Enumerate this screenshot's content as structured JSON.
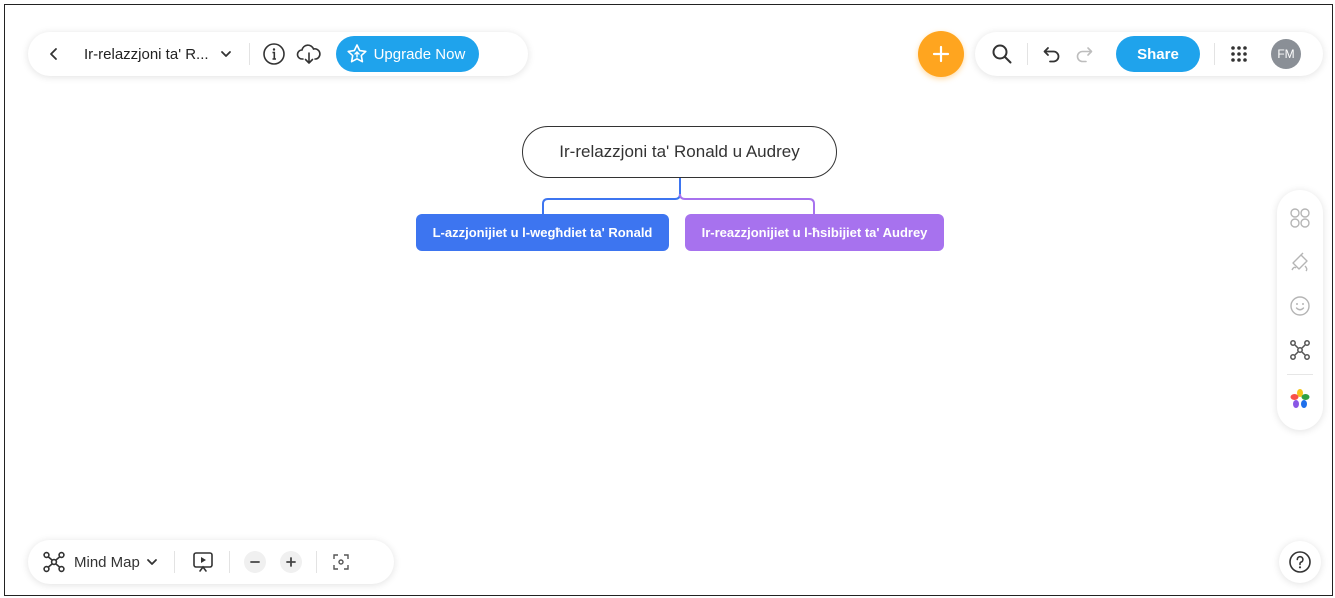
{
  "header": {
    "doc_title": "Ir-relazzjoni ta' R...",
    "upgrade_label": "Upgrade Now",
    "share_label": "Share",
    "avatar_initials": "FM"
  },
  "mindmap": {
    "root": "Ir-relazzjoni ta' Ronald u Audrey",
    "children": [
      {
        "label": "L-azzjonijiet u l-wegħdiet ta' Ronald",
        "color": "#3d75f0"
      },
      {
        "label": "Ir-reazzjonijiet u l-ħsibijiet ta' Audrey",
        "color": "#a772ee"
      }
    ]
  },
  "bottom": {
    "mode_label": "Mind Map"
  },
  "right_toolbar": {
    "tools": [
      "layout-icon",
      "style-brush-icon",
      "emoji-icon",
      "structure-icon",
      "color-palette-icon"
    ]
  },
  "colors": {
    "accent_blue": "#1fa3ec",
    "add_orange": "#ffa51f",
    "branch_blue": "#3d75f0",
    "branch_purple": "#a772ee"
  }
}
